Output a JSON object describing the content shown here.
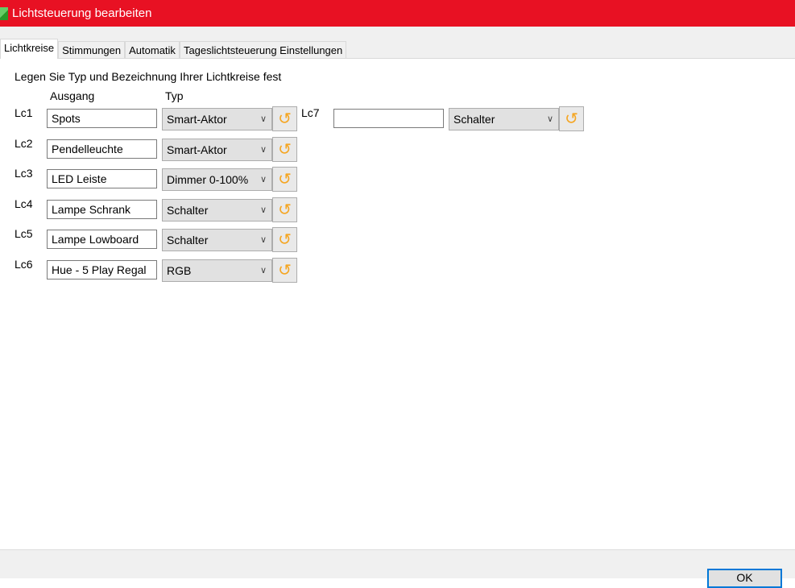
{
  "window": {
    "title": "Lichtsteuerung bearbeiten"
  },
  "tabs": [
    {
      "label": "Lichtkreise"
    },
    {
      "label": "Stimmungen"
    },
    {
      "label": "Automatik"
    },
    {
      "label": "Tageslichtsteuerung Einstellungen"
    }
  ],
  "main": {
    "instruction": "Legen Sie Typ und Bezeichnung Ihrer Lichtkreise fest",
    "col_output": "Ausgang",
    "col_type": "Typ",
    "rows": [
      {
        "label": "Lc1",
        "name": "Spots",
        "type": "Smart-Aktor"
      },
      {
        "label": "Lc2",
        "name": "Pendelleuchte",
        "type": "Smart-Aktor"
      },
      {
        "label": "Lc3",
        "name": "LED Leiste",
        "type": "Dimmer 0-100%"
      },
      {
        "label": "Lc4",
        "name": "Lampe Schrank",
        "type": "Schalter"
      },
      {
        "label": "Lc5",
        "name": "Lampe Lowboard",
        "type": "Schalter"
      },
      {
        "label": "Lc6",
        "name": "Hue - 5 Play Regal",
        "type": "RGB"
      },
      {
        "label": "Lc7",
        "name": "",
        "type": "Schalter"
      }
    ]
  },
  "footer": {
    "ok_label": "OK"
  },
  "colors": {
    "titlebar": "#e81123",
    "reset_icon": "#f5a623",
    "focus": "#0078d7"
  }
}
